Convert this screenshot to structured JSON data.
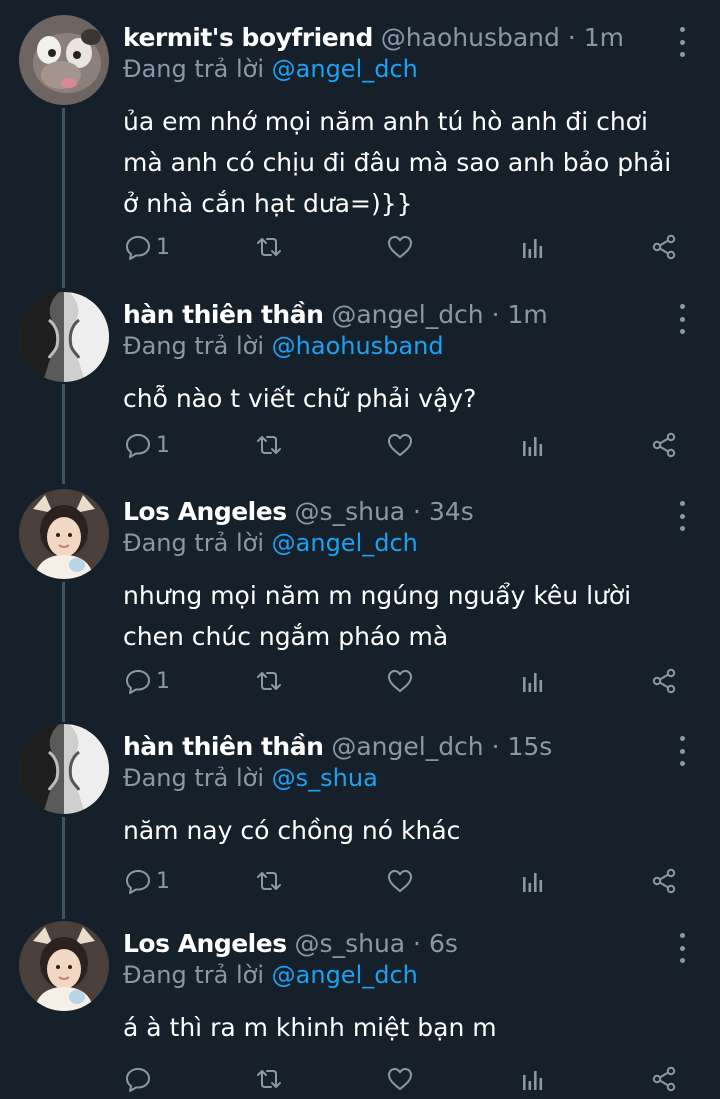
{
  "tweets": [
    {
      "name": "kermit's boyfriend",
      "handle": "@haohusband",
      "time": "1m",
      "replying_label": "Đang trả lời",
      "replying_to": "@angel_dch",
      "text": "ủa em nhớ mọi năm anh tú hò anh đi chơi mà anh có chịu đi đâu mà sao anh bảo phải ở nhà cắn hạt dưa=)}}",
      "reply_count": "1",
      "avatar_icon": "plush-toy-avatar"
    },
    {
      "name": "hàn thiên thần",
      "handle": "@angel_dch",
      "time": "1m",
      "replying_label": "Đang trả lời",
      "replying_to": "@haohusband",
      "text": "chỗ nào t viết chữ phải vậy?",
      "reply_count": "1",
      "avatar_icon": "mirrored-portrait-avatar"
    },
    {
      "name": "Los Angeles",
      "handle": "@s_shua",
      "time": "34s",
      "replying_label": "Đang trả lời",
      "replying_to": "@angel_dch",
      "text": "nhưng mọi năm m ngúng nguẩy kêu lười chen chúc ngắm pháo mà",
      "reply_count": "1",
      "avatar_icon": "deer-ears-portrait-avatar"
    },
    {
      "name": "hàn thiên thần",
      "handle": "@angel_dch",
      "time": "15s",
      "replying_label": "Đang trả lời",
      "replying_to": "@s_shua",
      "text": "năm nay có chồng nó khác",
      "reply_count": "1",
      "avatar_icon": "mirrored-portrait-avatar"
    },
    {
      "name": "Los Angeles",
      "handle": "@s_shua",
      "time": "6s",
      "replying_label": "Đang trả lời",
      "replying_to": "@angel_dch",
      "text": "á à thì ra m khinh miệt bạn m",
      "reply_count": "",
      "avatar_icon": "deer-ears-portrait-avatar"
    }
  ],
  "colors": {
    "background": "#15202b",
    "secondary_text": "#8899a6",
    "mention": "#1da1f2",
    "thread_line": "#3d5466"
  },
  "icons": [
    "reply-icon",
    "retweet-icon",
    "like-icon",
    "stats-icon",
    "share-icon",
    "more-options-icon"
  ]
}
